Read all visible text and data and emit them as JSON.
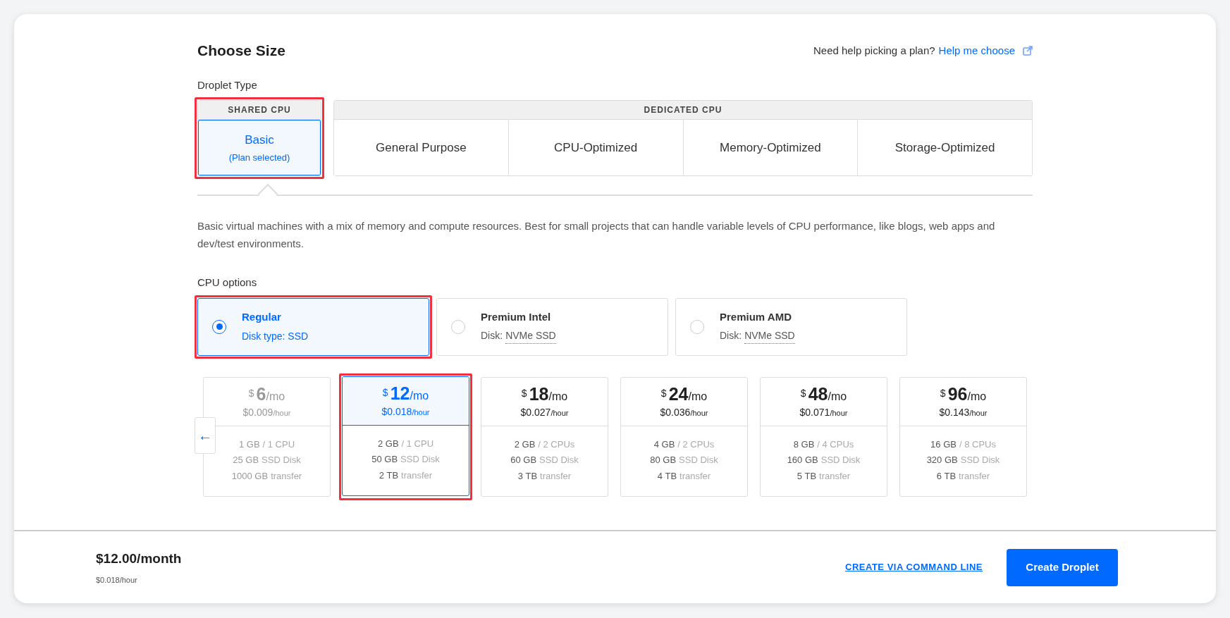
{
  "title": "Choose Size",
  "help": {
    "text": "Need help picking a plan?",
    "link": "Help me choose"
  },
  "droplet_type": {
    "label": "Droplet Type",
    "groups": [
      {
        "heading": "SHARED CPU",
        "options": [
          {
            "name": "Basic",
            "note": "(Plan selected)",
            "selected": true,
            "highlighted": true
          }
        ]
      },
      {
        "heading": "DEDICATED CPU",
        "options": [
          {
            "name": "General Purpose",
            "selected": false,
            "highlighted": false
          },
          {
            "name": "CPU-Optimized",
            "selected": false,
            "highlighted": false
          },
          {
            "name": "Memory-Optimized",
            "selected": false,
            "highlighted": false
          },
          {
            "name": "Storage-Optimized",
            "selected": false,
            "highlighted": false
          }
        ]
      }
    ]
  },
  "description": "Basic virtual machines with a mix of memory and compute resources. Best for small projects that can handle variable levels of CPU performance, like blogs, web apps and dev/test environments.",
  "cpu_options": {
    "label": "CPU options",
    "options": [
      {
        "name": "Regular",
        "disk_label": "Disk type: SSD",
        "selected": true,
        "highlighted": true
      },
      {
        "name": "Premium Intel",
        "disk_label": "Disk:",
        "disk_value": "NVMe SSD",
        "selected": false,
        "highlighted": false
      },
      {
        "name": "Premium AMD",
        "disk_label": "Disk:",
        "disk_value": "NVMe SSD",
        "selected": false,
        "highlighted": false
      }
    ]
  },
  "scroll_button": "←",
  "plans": [
    {
      "currency": "$",
      "amount": "6",
      "per": "/mo",
      "hourly": "$0.009",
      "hourly_unit": "/hour",
      "specs": [
        [
          "1 GB",
          "/ 1 CPU"
        ],
        [
          "25 GB",
          "SSD Disk"
        ],
        [
          "1000 GB",
          "transfer"
        ]
      ],
      "selected": false,
      "highlighted": false,
      "faded": true
    },
    {
      "currency": "$",
      "amount": "12",
      "per": "/mo",
      "hourly": "$0.018",
      "hourly_unit": "/hour",
      "specs": [
        [
          "2 GB",
          "/ 1 CPU"
        ],
        [
          "50 GB",
          "SSD Disk"
        ],
        [
          "2 TB",
          "transfer"
        ]
      ],
      "selected": true,
      "highlighted": true,
      "faded": false
    },
    {
      "currency": "$",
      "amount": "18",
      "per": "/mo",
      "hourly": "$0.027",
      "hourly_unit": "/hour",
      "specs": [
        [
          "2 GB",
          "/ 2 CPUs"
        ],
        [
          "60 GB",
          "SSD Disk"
        ],
        [
          "3 TB",
          "transfer"
        ]
      ],
      "selected": false,
      "highlighted": false,
      "faded": false
    },
    {
      "currency": "$",
      "amount": "24",
      "per": "/mo",
      "hourly": "$0.036",
      "hourly_unit": "/hour",
      "specs": [
        [
          "4 GB",
          "/ 2 CPUs"
        ],
        [
          "80 GB",
          "SSD Disk"
        ],
        [
          "4 TB",
          "transfer"
        ]
      ],
      "selected": false,
      "highlighted": false,
      "faded": false
    },
    {
      "currency": "$",
      "amount": "48",
      "per": "/mo",
      "hourly": "$0.071",
      "hourly_unit": "/hour",
      "specs": [
        [
          "8 GB",
          "/ 4 CPUs"
        ],
        [
          "160 GB",
          "SSD Disk"
        ],
        [
          "5 TB",
          "transfer"
        ]
      ],
      "selected": false,
      "highlighted": false,
      "faded": false
    },
    {
      "currency": "$",
      "amount": "96",
      "per": "/mo",
      "hourly": "$0.143",
      "hourly_unit": "/hour",
      "specs": [
        [
          "16 GB",
          "/ 8 CPUs"
        ],
        [
          "320 GB",
          "SSD Disk"
        ],
        [
          "6 TB",
          "transfer"
        ]
      ],
      "selected": false,
      "highlighted": false,
      "faded": false
    }
  ],
  "footer": {
    "total": "$12.00/month",
    "hourly": "$0.018/hour",
    "cli_link": "CREATE VIA COMMAND LINE",
    "create_button": "Create Droplet"
  }
}
